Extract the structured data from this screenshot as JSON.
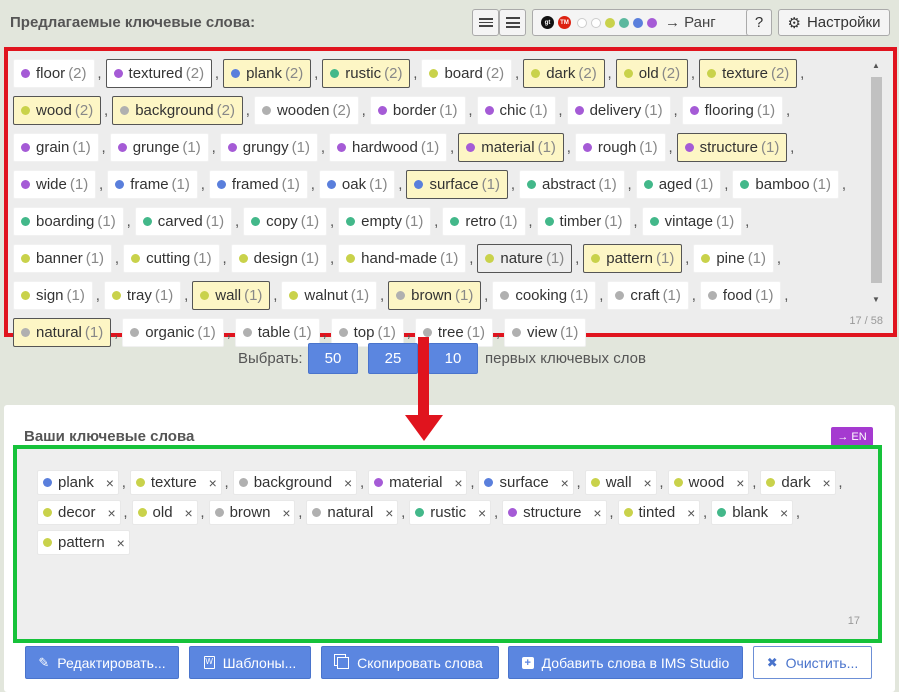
{
  "header": {
    "title": "Предлагаемые ключевые слова:",
    "rank_label": "→ Ранг",
    "help_label": "?",
    "settings_label": "Настройки",
    "gt_badge": "gt",
    "tm_badge": "TM",
    "color_dots": [
      "#ffffff",
      "#ffffff",
      "#c9d24b",
      "#5bb89e",
      "#5a7fdc",
      "#a55bd6"
    ]
  },
  "suggested": {
    "counter": "17 / 58",
    "items": [
      {
        "word": "floor",
        "count": "(2)",
        "color": "#a55bd6",
        "state": "plain"
      },
      {
        "word": "textured",
        "count": "(2)",
        "color": "#a55bd6",
        "state": "outline"
      },
      {
        "word": "plank",
        "count": "(2)",
        "color": "#5a7fdc",
        "state": "selected"
      },
      {
        "word": "rustic",
        "count": "(2)",
        "color": "#43b88a",
        "state": "selected"
      },
      {
        "word": "board",
        "count": "(2)",
        "color": "#c9d24b",
        "state": "plain"
      },
      {
        "word": "dark",
        "count": "(2)",
        "color": "#c9d24b",
        "state": "selected"
      },
      {
        "word": "old",
        "count": "(2)",
        "color": "#c9d24b",
        "state": "selected"
      },
      {
        "word": "texture",
        "count": "(2)",
        "color": "#c9d24b",
        "state": "selected"
      },
      {
        "word": "wood",
        "count": "(2)",
        "color": "#c9d24b",
        "state": "selected"
      },
      {
        "word": "background",
        "count": "(2)",
        "color": "#b0b0b0",
        "state": "selected"
      },
      {
        "word": "wooden",
        "count": "(2)",
        "color": "#b0b0b0",
        "state": "plain"
      },
      {
        "word": "border",
        "count": "(1)",
        "color": "#a55bd6",
        "state": "plain"
      },
      {
        "word": "chic",
        "count": "(1)",
        "color": "#a55bd6",
        "state": "plain"
      },
      {
        "word": "delivery",
        "count": "(1)",
        "color": "#a55bd6",
        "state": "plain"
      },
      {
        "word": "flooring",
        "count": "(1)",
        "color": "#a55bd6",
        "state": "plain"
      },
      {
        "word": "grain",
        "count": "(1)",
        "color": "#a55bd6",
        "state": "plain"
      },
      {
        "word": "grunge",
        "count": "(1)",
        "color": "#a55bd6",
        "state": "plain"
      },
      {
        "word": "grungy",
        "count": "(1)",
        "color": "#a55bd6",
        "state": "plain"
      },
      {
        "word": "hardwood",
        "count": "(1)",
        "color": "#a55bd6",
        "state": "plain"
      },
      {
        "word": "material",
        "count": "(1)",
        "color": "#a55bd6",
        "state": "selected"
      },
      {
        "word": "rough",
        "count": "(1)",
        "color": "#a55bd6",
        "state": "plain"
      },
      {
        "word": "structure",
        "count": "(1)",
        "color": "#a55bd6",
        "state": "selected"
      },
      {
        "word": "wide",
        "count": "(1)",
        "color": "#a55bd6",
        "state": "plain"
      },
      {
        "word": "frame",
        "count": "(1)",
        "color": "#5a7fdc",
        "state": "plain"
      },
      {
        "word": "framed",
        "count": "(1)",
        "color": "#5a7fdc",
        "state": "plain"
      },
      {
        "word": "oak",
        "count": "(1)",
        "color": "#5a7fdc",
        "state": "plain"
      },
      {
        "word": "surface",
        "count": "(1)",
        "color": "#5a7fdc",
        "state": "selected"
      },
      {
        "word": "abstract",
        "count": "(1)",
        "color": "#43b88a",
        "state": "plain"
      },
      {
        "word": "aged",
        "count": "(1)",
        "color": "#43b88a",
        "state": "plain"
      },
      {
        "word": "bamboo",
        "count": "(1)",
        "color": "#43b88a",
        "state": "plain"
      },
      {
        "word": "boarding",
        "count": "(1)",
        "color": "#43b88a",
        "state": "plain"
      },
      {
        "word": "carved",
        "count": "(1)",
        "color": "#43b88a",
        "state": "plain"
      },
      {
        "word": "copy",
        "count": "(1)",
        "color": "#43b88a",
        "state": "plain"
      },
      {
        "word": "empty",
        "count": "(1)",
        "color": "#43b88a",
        "state": "plain"
      },
      {
        "word": "retro",
        "count": "(1)",
        "color": "#43b88a",
        "state": "plain"
      },
      {
        "word": "timber",
        "count": "(1)",
        "color": "#43b88a",
        "state": "plain"
      },
      {
        "word": "vintage",
        "count": "(1)",
        "color": "#43b88a",
        "state": "plain"
      },
      {
        "word": "banner",
        "count": "(1)",
        "color": "#c9d24b",
        "state": "plain"
      },
      {
        "word": "cutting",
        "count": "(1)",
        "color": "#c9d24b",
        "state": "plain"
      },
      {
        "word": "design",
        "count": "(1)",
        "color": "#c9d24b",
        "state": "plain"
      },
      {
        "word": "hand-made",
        "count": "(1)",
        "color": "#c9d24b",
        "state": "plain"
      },
      {
        "word": "nature",
        "count": "(1)",
        "color": "#c9d24b",
        "state": "green"
      },
      {
        "word": "pattern",
        "count": "(1)",
        "color": "#c9d24b",
        "state": "selected"
      },
      {
        "word": "pine",
        "count": "(1)",
        "color": "#c9d24b",
        "state": "plain"
      },
      {
        "word": "sign",
        "count": "(1)",
        "color": "#c9d24b",
        "state": "plain"
      },
      {
        "word": "tray",
        "count": "(1)",
        "color": "#c9d24b",
        "state": "plain"
      },
      {
        "word": "wall",
        "count": "(1)",
        "color": "#c9d24b",
        "state": "selected"
      },
      {
        "word": "walnut",
        "count": "(1)",
        "color": "#c9d24b",
        "state": "plain"
      },
      {
        "word": "brown",
        "count": "(1)",
        "color": "#b0b0b0",
        "state": "selected"
      },
      {
        "word": "cooking",
        "count": "(1)",
        "color": "#b0b0b0",
        "state": "plain"
      },
      {
        "word": "craft",
        "count": "(1)",
        "color": "#b0b0b0",
        "state": "plain"
      },
      {
        "word": "food",
        "count": "(1)",
        "color": "#b0b0b0",
        "state": "plain"
      },
      {
        "word": "natural",
        "count": "(1)",
        "color": "#b0b0b0",
        "state": "selected"
      },
      {
        "word": "organic",
        "count": "(1)",
        "color": "#b0b0b0",
        "state": "plain"
      },
      {
        "word": "table",
        "count": "(1)",
        "color": "#b0b0b0",
        "state": "plain"
      },
      {
        "word": "top",
        "count": "(1)",
        "color": "#b0b0b0",
        "state": "plain"
      },
      {
        "word": "tree",
        "count": "(1)",
        "color": "#b0b0b0",
        "state": "plain"
      },
      {
        "word": "view",
        "count": "(1)",
        "color": "#b0b0b0",
        "state": "plain"
      }
    ]
  },
  "select_row": {
    "label": "Выбрать:",
    "options": [
      "50",
      "25",
      "10"
    ],
    "suffix": "первых ключевых слов"
  },
  "your_keywords": {
    "title": "Ваши ключевые слова",
    "lang_button": "→ EN",
    "counter": "17",
    "items": [
      {
        "word": "plank",
        "color": "#5a7fdc"
      },
      {
        "word": "texture",
        "color": "#c9d24b"
      },
      {
        "word": "background",
        "color": "#b0b0b0"
      },
      {
        "word": "material",
        "color": "#a55bd6"
      },
      {
        "word": "surface",
        "color": "#5a7fdc"
      },
      {
        "word": "wall",
        "color": "#c9d24b"
      },
      {
        "word": "wood",
        "color": "#c9d24b"
      },
      {
        "word": "dark",
        "color": "#c9d24b"
      },
      {
        "word": "decor",
        "color": "#c9d24b"
      },
      {
        "word": "old",
        "color": "#c9d24b"
      },
      {
        "word": "brown",
        "color": "#b0b0b0"
      },
      {
        "word": "natural",
        "color": "#b0b0b0"
      },
      {
        "word": "rustic",
        "color": "#43b88a"
      },
      {
        "word": "structure",
        "color": "#a55bd6"
      },
      {
        "word": "tinted",
        "color": "#c9d24b"
      },
      {
        "word": "blank",
        "color": "#43b88a"
      },
      {
        "word": "pattern",
        "color": "#c9d24b"
      }
    ]
  },
  "actions": {
    "edit": "Редактировать...",
    "templates": "Шаблоны...",
    "copy": "Скопировать слова",
    "add_ims": "Добавить слова в IMS Studio",
    "clear": "Очистить..."
  }
}
